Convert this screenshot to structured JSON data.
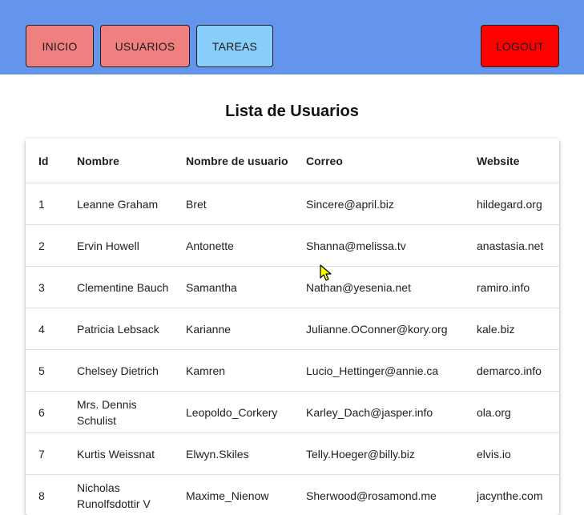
{
  "nav": {
    "inicio": "INICIO",
    "usuarios": "USUARIOS",
    "tareas": "TAREAS",
    "logout": "LOGOUT"
  },
  "page": {
    "title": "Lista de Usuarios"
  },
  "table": {
    "headers": {
      "id": "Id",
      "nombre": "Nombre",
      "usuario": "Nombre de usuario",
      "correo": "Correo",
      "website": "Website"
    },
    "rows": [
      {
        "id": "1",
        "nombre": "Leanne Graham",
        "usuario": "Bret",
        "correo": "Sincere@april.biz",
        "website": "hildegard.org"
      },
      {
        "id": "2",
        "nombre": "Ervin Howell",
        "usuario": "Antonette",
        "correo": "Shanna@melissa.tv",
        "website": "anastasia.net"
      },
      {
        "id": "3",
        "nombre": "Clementine Bauch",
        "usuario": "Samantha",
        "correo": "Nathan@yesenia.net",
        "website": "ramiro.info"
      },
      {
        "id": "4",
        "nombre": "Patricia Lebsack",
        "usuario": "Karianne",
        "correo": "Julianne.OConner@kory.org",
        "website": "kale.biz"
      },
      {
        "id": "5",
        "nombre": "Chelsey Dietrich",
        "usuario": "Kamren",
        "correo": "Lucio_Hettinger@annie.ca",
        "website": "demarco.info"
      },
      {
        "id": "6",
        "nombre": "Mrs. Dennis Schulist",
        "usuario": "Leopoldo_Corkery",
        "correo": "Karley_Dach@jasper.info",
        "website": "ola.org"
      },
      {
        "id": "7",
        "nombre": "Kurtis Weissnat",
        "usuario": "Elwyn.Skiles",
        "correo": "Telly.Hoeger@billy.biz",
        "website": "elvis.io"
      },
      {
        "id": "8",
        "nombre": "Nicholas Runolfsdottir V",
        "usuario": "Maxime_Nienow",
        "correo": "Sherwood@rosamond.me",
        "website": "jacynthe.com"
      }
    ]
  },
  "colors": {
    "navbar": "#6495ed",
    "btn_inicio": "#f08080",
    "btn_usuarios": "#f08080",
    "btn_tareas": "#87cefa",
    "btn_logout": "#ff0000",
    "cursor": "#ffff00"
  },
  "icons": {
    "cursor": "mouse-pointer-icon"
  }
}
